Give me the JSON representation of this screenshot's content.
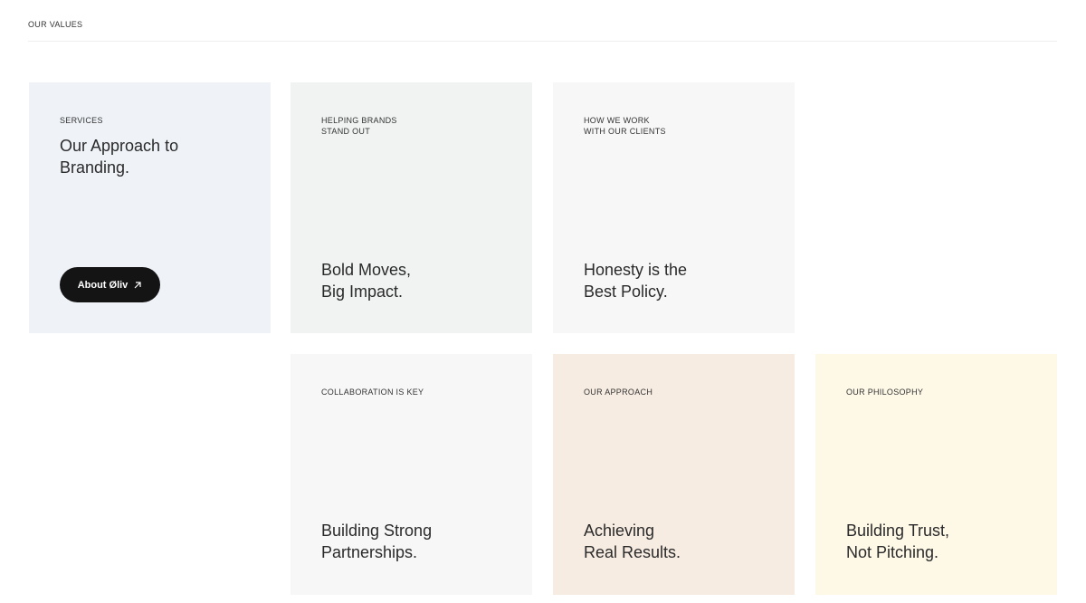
{
  "section": {
    "label": "OUR VALUES"
  },
  "cards": [
    {
      "eyebrow": "SERVICES",
      "heading": "Our Approach to\nBranding.",
      "button_label": "About Øliv"
    },
    {
      "eyebrow": "HELPING BRANDS\nSTAND OUT",
      "heading": "Bold Moves,\nBig Impact."
    },
    {
      "eyebrow": "HOW WE WORK\nWITH OUR CLIENTS",
      "heading": "Honesty is the\nBest Policy."
    },
    {
      "eyebrow": "COLLABORATION IS KEY",
      "heading": "Building Strong\nPartnerships."
    },
    {
      "eyebrow": "OUR APPROACH",
      "heading": "Achieving\nReal Results."
    },
    {
      "eyebrow": "OUR PHILOSOPHY",
      "heading": "Building Trust,\nNot Pitching."
    }
  ],
  "icons": {
    "button_icon": "arrow-up-right-icon"
  },
  "colors": {
    "card_services": "#eff3f8",
    "card_bold_moves": "#f0f3f2",
    "card_honesty": "#f7f7f7",
    "card_collaboration": "#f7f7f7",
    "card_approach": "#f7ece2",
    "card_philosophy": "#fef8e7",
    "button_bg": "#141414"
  }
}
